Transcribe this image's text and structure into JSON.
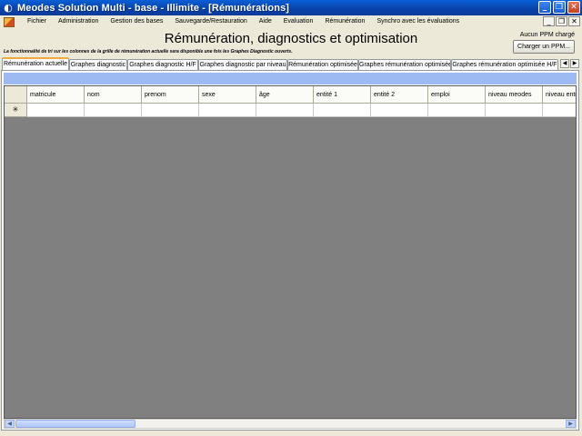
{
  "window": {
    "title": "Meodes Solution Multi - base - Illimite - [Rémunérations]"
  },
  "menu": [
    "Fichier",
    "Administration",
    "Gestion des bases",
    "Sauvegarde/Restauration",
    "Aide",
    "Evaluation",
    "Rémunération",
    "Synchro avec les évaluations"
  ],
  "header": {
    "title": "Rémunération, diagnostics et optimisation",
    "ppm_status": "Aucun PPM chargé",
    "load_ppm_label": "Charger un PPM...",
    "note": "La fonctionnalité de tri sur les colonnes de la grille de rémunération actuelle sera disponible une fois les Graphes Diagnostic ouverts."
  },
  "tabs": [
    "Rémunération actuelle",
    "Graphes diagnostic",
    "Graphes diagnostic H/F",
    "Graphes diagnostic par niveau",
    "Rémunération optimisée",
    "Graphes rémunération optimisée",
    "Graphes rémunération optimisée H/F"
  ],
  "grid": {
    "columns": [
      "matricule",
      "nom",
      "prenom",
      "sexe",
      "âge",
      "entité 1",
      "entité 2",
      "emploi",
      "niveau meodes",
      "niveau entreprise"
    ],
    "new_row_marker": "✳"
  },
  "icons": {
    "app": "meodes-app-icon",
    "mdi": "mdi-child-icon",
    "minimize": "minimize-icon",
    "maximize": "maximize-icon",
    "close": "close-icon",
    "scroll_left": "chevron-left-icon",
    "scroll_right": "chevron-right-icon"
  },
  "colors": {
    "titlebar": "#0a5fd6",
    "tab_active_border": "#f3a83c",
    "grid_background": "#808080",
    "blue_strip": "#9ebaf2"
  }
}
